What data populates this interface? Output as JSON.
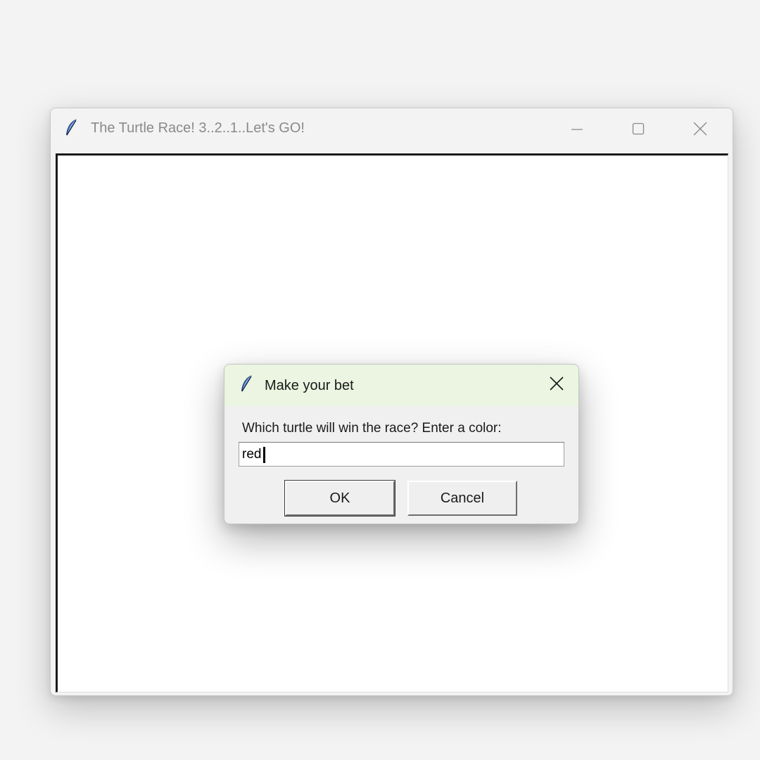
{
  "main_window": {
    "title": "The Turtle Race! 3..2..1..Let's GO!",
    "icon": "feather-icon",
    "controls": {
      "minimize": "minimize-icon",
      "maximize": "maximize-icon",
      "close": "close-icon"
    }
  },
  "dialog": {
    "title": "Make your bet",
    "icon": "feather-icon",
    "prompt": "Which turtle will win the race? Enter a color:",
    "input_value": "red",
    "ok_label": "OK",
    "cancel_label": "Cancel",
    "titlebar_color": "#ebf5e1"
  }
}
